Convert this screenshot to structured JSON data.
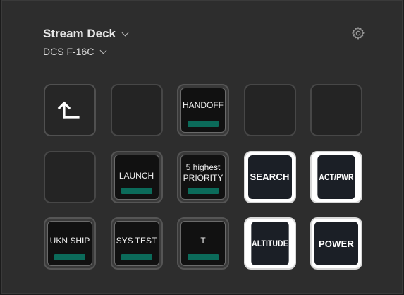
{
  "header": {
    "device_name": "Stream Deck",
    "profile_name": "DCS F-16C"
  },
  "icons": {
    "device_dropdown": "chevron-down-icon",
    "profile_dropdown": "chevron-down-icon",
    "settings": "gear-icon",
    "back": "back-arrow-icon"
  },
  "colors": {
    "panel_bg": "#2d2d2d",
    "led_green": "#0b6b5a",
    "bold_key_border": "#ffffff"
  },
  "keys": {
    "r1c3": {
      "label": "HANDOFF"
    },
    "r2c2": {
      "label": "LAUNCH"
    },
    "r2c3": {
      "line1": "5 highest",
      "line2": "PRIORITY"
    },
    "r2c4": {
      "label": "SEARCH"
    },
    "r2c5": {
      "label": "ACT/PWR"
    },
    "r3c1": {
      "label": "UKN SHIP"
    },
    "r3c2": {
      "label": "SYS TEST"
    },
    "r3c3": {
      "label": "T"
    },
    "r3c4": {
      "label": "ALTITUDE"
    },
    "r3c5": {
      "label": "POWER"
    }
  }
}
